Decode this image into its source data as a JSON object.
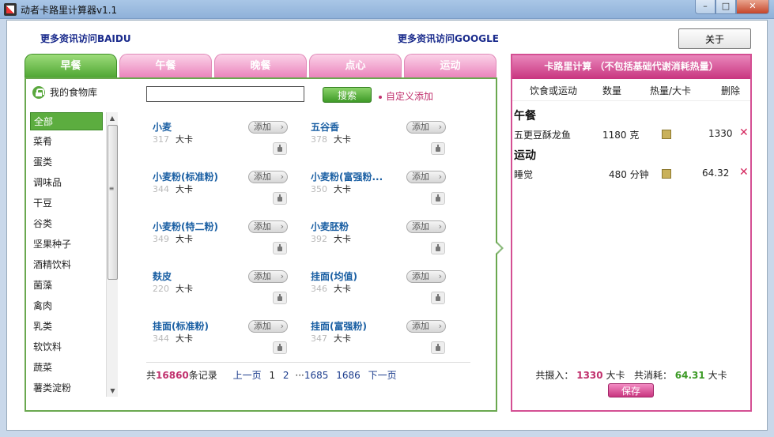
{
  "window": {
    "title": "动者卡路里计算器v1.1",
    "min": "–",
    "max": "□",
    "close": "✕"
  },
  "header": {
    "link_baidu": "更多资讯访问BAIDU",
    "link_google": "更多资讯访问GOOGLE",
    "about": "关于"
  },
  "tabs": [
    {
      "label": "早餐",
      "active": true
    },
    {
      "label": "午餐"
    },
    {
      "label": "晚餐"
    },
    {
      "label": "点心"
    },
    {
      "label": "运动"
    }
  ],
  "library": {
    "label": "我的食物库"
  },
  "categories": [
    "全部",
    "菜肴",
    "蛋类",
    "调味品",
    "干豆",
    "谷类",
    "坚果种子",
    "酒精饮料",
    "菌藻",
    "禽肉",
    "乳类",
    "软饮料",
    "蔬菜",
    "薯类淀粉"
  ],
  "search": {
    "value": "",
    "button": "搜索",
    "custom_add": "自定义添加"
  },
  "foods": [
    {
      "name": "小麦",
      "kcal": "317",
      "unit": "大卡",
      "add": "添加"
    },
    {
      "name": "五谷香",
      "kcal": "378",
      "unit": "大卡",
      "add": "添加"
    },
    {
      "name": "小麦粉(标准粉)",
      "kcal": "344",
      "unit": "大卡",
      "add": "添加"
    },
    {
      "name": "小麦粉(富强粉...",
      "kcal": "350",
      "unit": "大卡",
      "add": "添加"
    },
    {
      "name": "小麦粉(特二粉)",
      "kcal": "349",
      "unit": "大卡",
      "add": "添加"
    },
    {
      "name": "小麦胚粉",
      "kcal": "392",
      "unit": "大卡",
      "add": "添加"
    },
    {
      "name": "麸皮",
      "kcal": "220",
      "unit": "大卡",
      "add": "添加"
    },
    {
      "name": "挂面(均值)",
      "kcal": "346",
      "unit": "大卡",
      "add": "添加"
    },
    {
      "name": "挂面(标准粉)",
      "kcal": "344",
      "unit": "大卡",
      "add": "添加"
    },
    {
      "name": "挂面(富强粉)",
      "kcal": "347",
      "unit": "大卡",
      "add": "添加"
    }
  ],
  "pager": {
    "prefix": "共",
    "count": "16860",
    "suffix": "条记录",
    "prev": "上一页",
    "p1": "1",
    "p2": "2",
    "ellipsis": "···",
    "p1685": "1685",
    "p1686": "1686",
    "next": "下一页"
  },
  "calc": {
    "title": "卡路里计算 （不包括基础代谢消耗热量）",
    "col_item": "饮食或运动",
    "col_qty": "数量",
    "col_heat": "热量/大卡",
    "col_del": "删除",
    "section_lunch": "午餐",
    "lunch_item": {
      "name": "五更豆酥龙鱼",
      "qty": "1180 克",
      "kcal": "1330"
    },
    "section_sport": "运动",
    "sport_item": {
      "name": "睡觉",
      "qty": "480 分钟",
      "kcal": "64.32"
    },
    "delete_glyph": "✕",
    "intake_label": "共摄入：",
    "intake_value": "1330",
    "intake_unit": "大卡",
    "burn_label": "共消耗：",
    "burn_value": "64.31",
    "burn_unit": "大卡",
    "save": "保存"
  }
}
